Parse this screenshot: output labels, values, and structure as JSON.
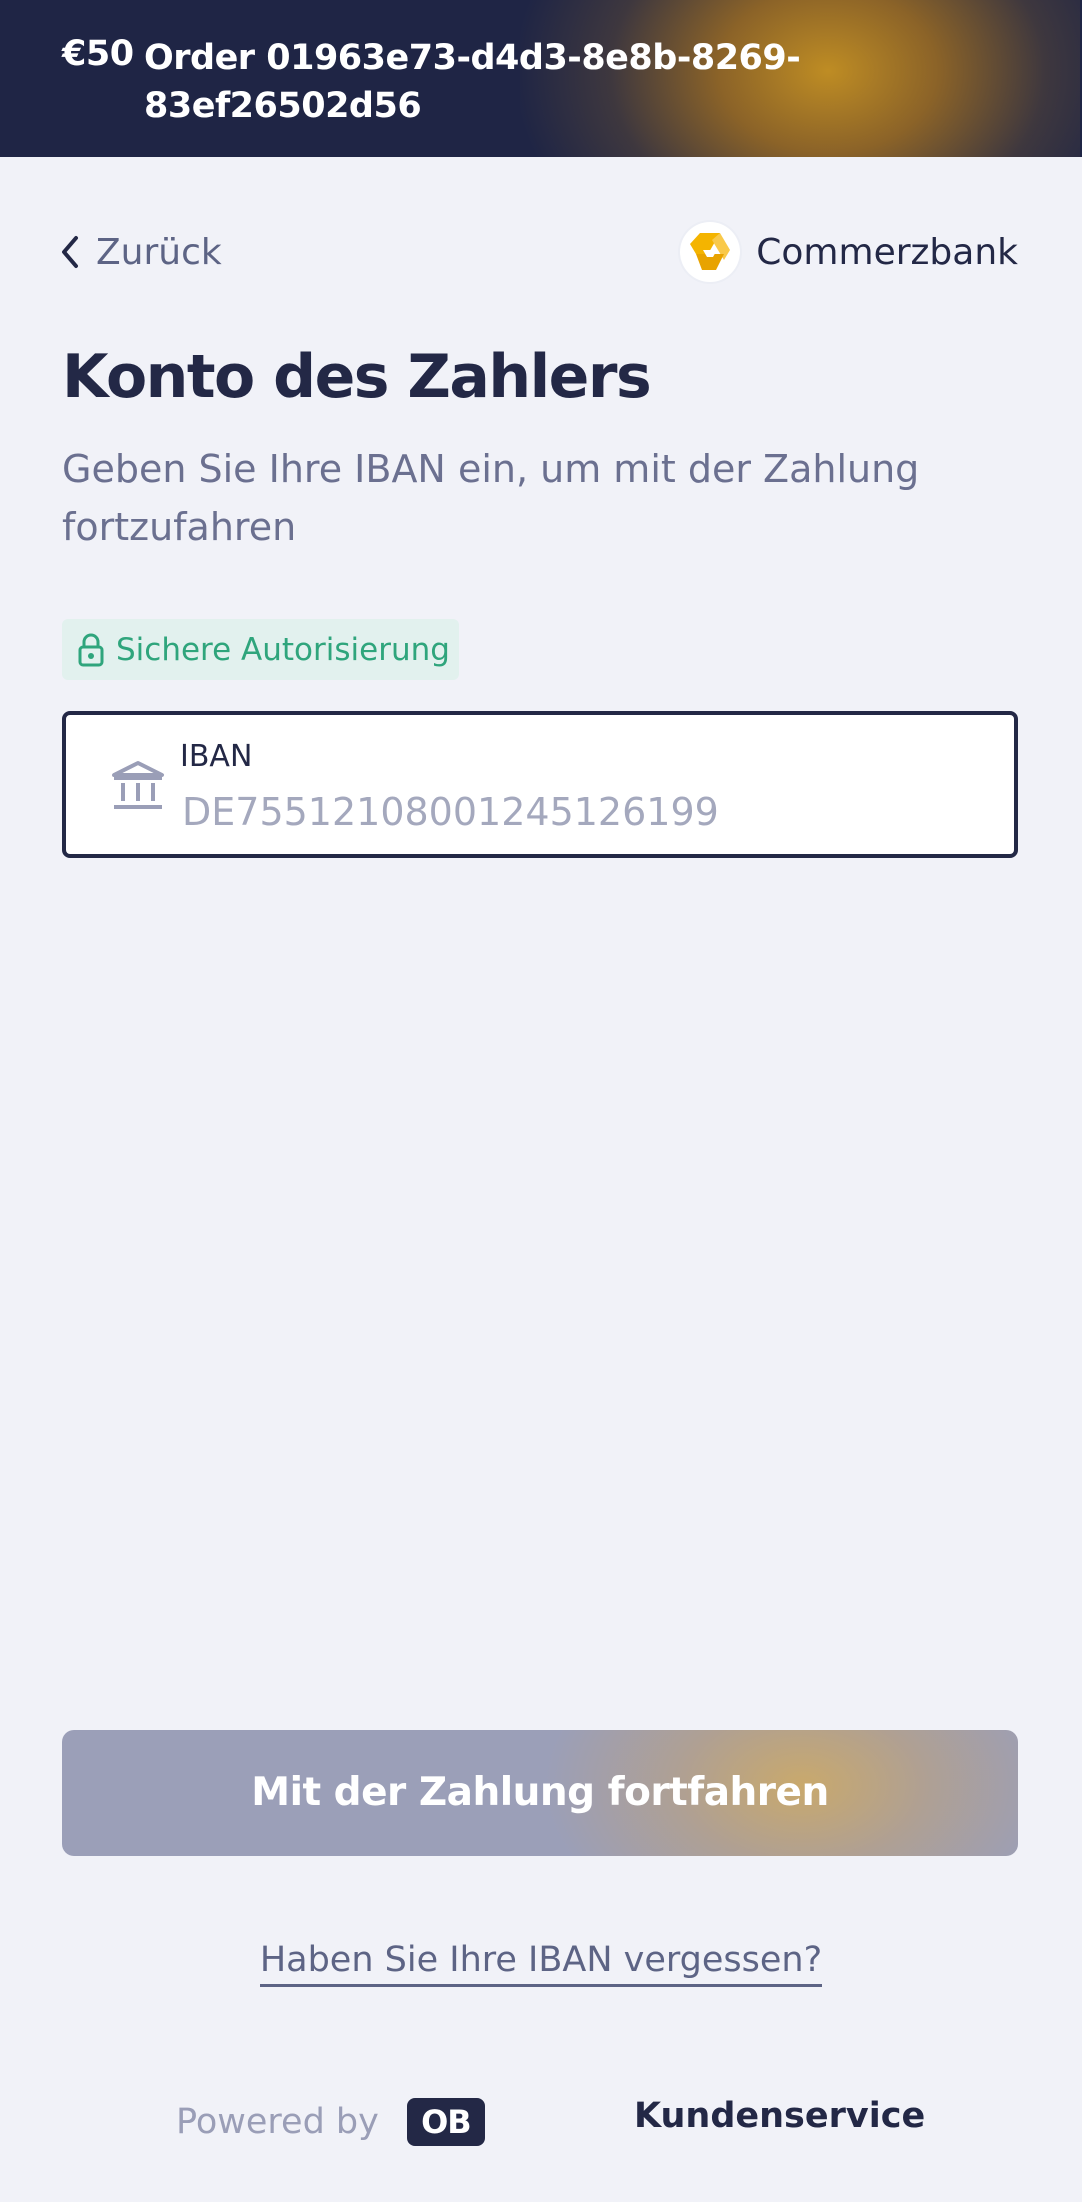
{
  "header": {
    "amount": "€50",
    "order_line1": "Order 01963e73-d4d3-8e8b-8269-",
    "order_line2": "83ef26502d56",
    "bg_color": "#1f2545",
    "accent_color": "#c79222"
  },
  "nav": {
    "back_label": "Zurück",
    "back_icon": "chevron-left-icon",
    "bank_name": "Commerzbank",
    "bank_logo_icon": "commerzbank-logo-icon"
  },
  "main": {
    "title": "Konto des Zahlers",
    "subtitle": "Geben Sie Ihre IBAN ein, um mit der Zahlung fortzufahren",
    "secure_badge": {
      "label": "Sichere Autorisierung",
      "icon": "lock-icon",
      "color": "#2fa57c"
    },
    "iban_field": {
      "label": "IBAN",
      "value": "",
      "placeholder": "DE75512108001245126199",
      "icon": "bank-building-icon"
    },
    "continue_button": {
      "label": "Mit der Zahlung fortfahren",
      "state": "disabled"
    },
    "forgot_link": "Haben Sie Ihre IBAN vergessen?"
  },
  "footer": {
    "powered_by": "Powered by",
    "ob_logo": "OB",
    "support_label": "Kundenservice"
  }
}
